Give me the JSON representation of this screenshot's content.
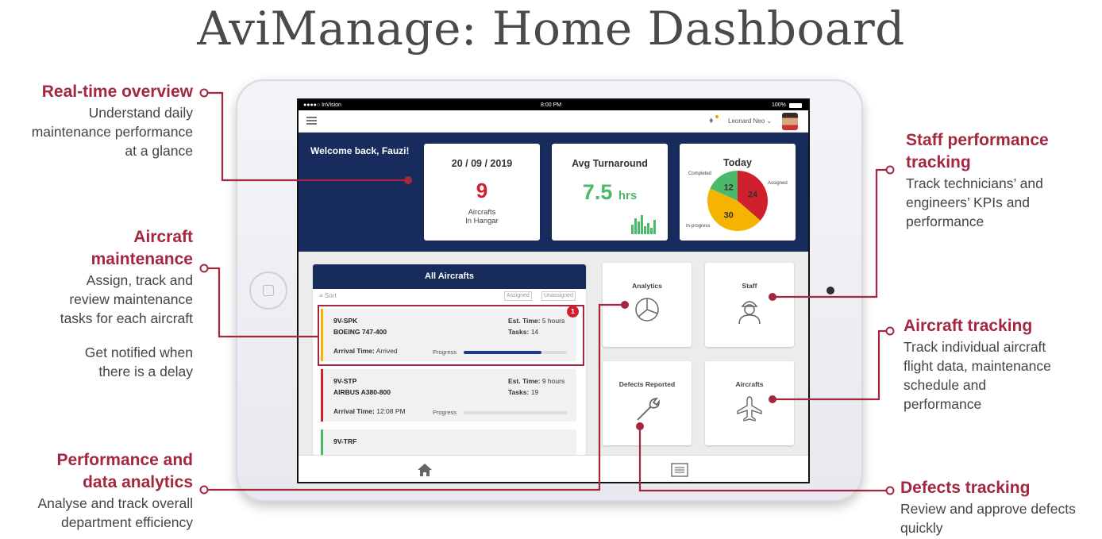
{
  "title": "AviManage: Home Dashboard",
  "annotations": {
    "realtime": {
      "heading": "Real-time overview",
      "lines": [
        "Understand daily",
        "maintenance performance",
        "at a glance"
      ]
    },
    "maintenance": {
      "heading_lines": [
        "Aircraft",
        "maintenance"
      ],
      "lines": [
        "Assign, track and",
        "review maintenance",
        "tasks for each aircraft"
      ],
      "extra_lines": [
        "Get notified when",
        "there is a delay"
      ]
    },
    "analytics": {
      "heading_lines": [
        "Performance and",
        "data analytics"
      ],
      "lines": [
        "Analyse and track overall",
        "department efficiency"
      ]
    },
    "staff": {
      "heading_lines": [
        "Staff performance",
        "tracking"
      ],
      "lines": [
        "Track technicians’ and",
        "engineers’ KPIs and",
        "performance"
      ]
    },
    "tracking": {
      "heading": "Aircraft tracking",
      "lines": [
        "Track individual aircraft",
        "flight data, maintenance",
        "schedule and",
        "performance"
      ]
    },
    "defects": {
      "heading": "Defects tracking",
      "lines": [
        "Review and approve defects",
        "quickly"
      ]
    }
  },
  "app": {
    "status_bar": {
      "carrier": "●●●●○ InVision",
      "time": "8:00 PM",
      "battery": "100%"
    },
    "nav": {
      "user": "Leonard Neo",
      "icons": [
        "menu-icon",
        "bell-icon",
        "chevron-down-icon"
      ]
    },
    "welcome": "Welcome back, Fauzi!",
    "date_card": {
      "date": "20 / 09 / 2019",
      "value": "9",
      "caption_line1": "Aircrafts",
      "caption_line2": "In Hangar"
    },
    "turnaround_card": {
      "title": "Avg Turnaround",
      "value": "7.5",
      "unit": "hrs"
    },
    "today_card": {
      "title": "Today",
      "slices": [
        {
          "label": "Assigned",
          "value": "24",
          "color": "#d0202e"
        },
        {
          "label": "In-progress",
          "value": "30",
          "color": "#f5b400"
        },
        {
          "label": "Completed",
          "value": "12",
          "color": "#4cb86a"
        }
      ]
    },
    "aircraft_list": {
      "header": "All Aircrafts",
      "sort_label": "Sort",
      "filters": [
        "Assigned",
        "Unassigned"
      ],
      "progress_label": "Progress",
      "est_label": "Est. Time:",
      "tasks_label": "Tasks:",
      "arrival_label": "Arrival Time:",
      "notification_count": "1",
      "rows": [
        {
          "reg": "9V-SPK",
          "model": "BOEING 747-400",
          "est": "5 hours",
          "tasks": "14",
          "arrival": "Arrived",
          "progress": 0.75,
          "color": "#f5b400"
        },
        {
          "reg": "9V-STP",
          "model": "AIRBUS A380-800",
          "est": "9 hours",
          "tasks": "19",
          "arrival": "12:08 PM",
          "progress": 0,
          "color": "#d0202e"
        },
        {
          "reg": "9V-TRF",
          "model": "",
          "est": "",
          "tasks": "",
          "arrival": "",
          "progress": 0,
          "color": "#4cb86a"
        }
      ]
    },
    "tiles": {
      "analytics": "Analytics",
      "staff": "Staff",
      "defects": "Defects Reported",
      "aircrafts": "Aircrafts"
    }
  }
}
